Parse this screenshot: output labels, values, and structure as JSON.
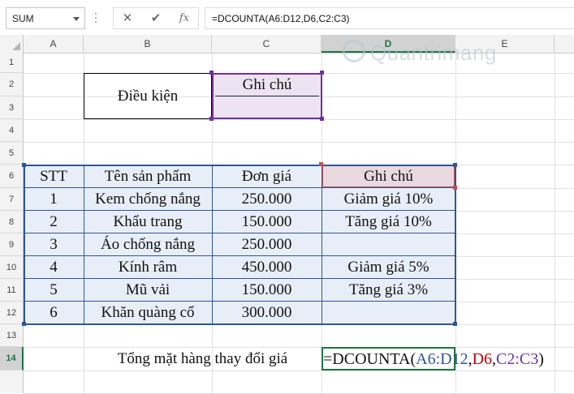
{
  "formula_bar": {
    "name_box": "SUM",
    "cancel_icon": "✕",
    "enter_icon": "✔",
    "fx_label": "fx",
    "formula": "=DCOUNTA(A6:D12,D6,C2:C3)"
  },
  "columns": [
    "A",
    "B",
    "C",
    "D",
    "E"
  ],
  "rows": [
    "1",
    "2",
    "3",
    "4",
    "5",
    "6",
    "7",
    "8",
    "9",
    "10",
    "11",
    "12",
    "13",
    "14"
  ],
  "active_cell": {
    "column": "D",
    "row": "14"
  },
  "criteria": {
    "label": "Điều kiện",
    "header": "Ghi chú"
  },
  "table": {
    "headers": [
      "STT",
      "Tên sản phẩm",
      "Đơn giá",
      "Ghi chú"
    ],
    "rows": [
      [
        "1",
        "Kem chống nắng",
        "250.000",
        "Giảm giá 10%"
      ],
      [
        "2",
        "Khẩu trang",
        "150.000",
        "Tăng giá 10%"
      ],
      [
        "3",
        "Áo chống nắng",
        "250.000",
        ""
      ],
      [
        "4",
        "Kính râm",
        "450.000",
        "Giảm giá 5%"
      ],
      [
        "5",
        "Mũ vải",
        "150.000",
        "Tăng giá 3%"
      ],
      [
        "6",
        "Khăn quàng cổ",
        "300.000",
        ""
      ]
    ]
  },
  "summary_label": "Tổng mặt hàng thay đổi giá",
  "cell_formula": {
    "prefix": "=DCOUNTA(",
    "ref1": "A6:D12",
    "sep1": ",",
    "ref2": "D6",
    "sep2": ",",
    "ref3": "C2:C3",
    "suffix": ")"
  },
  "reference_colors": {
    "ref1": "#2f5597",
    "ref2": "#c00000",
    "ref3": "#7030a0",
    "active": "#217346"
  },
  "watermark": "Quantrimang"
}
